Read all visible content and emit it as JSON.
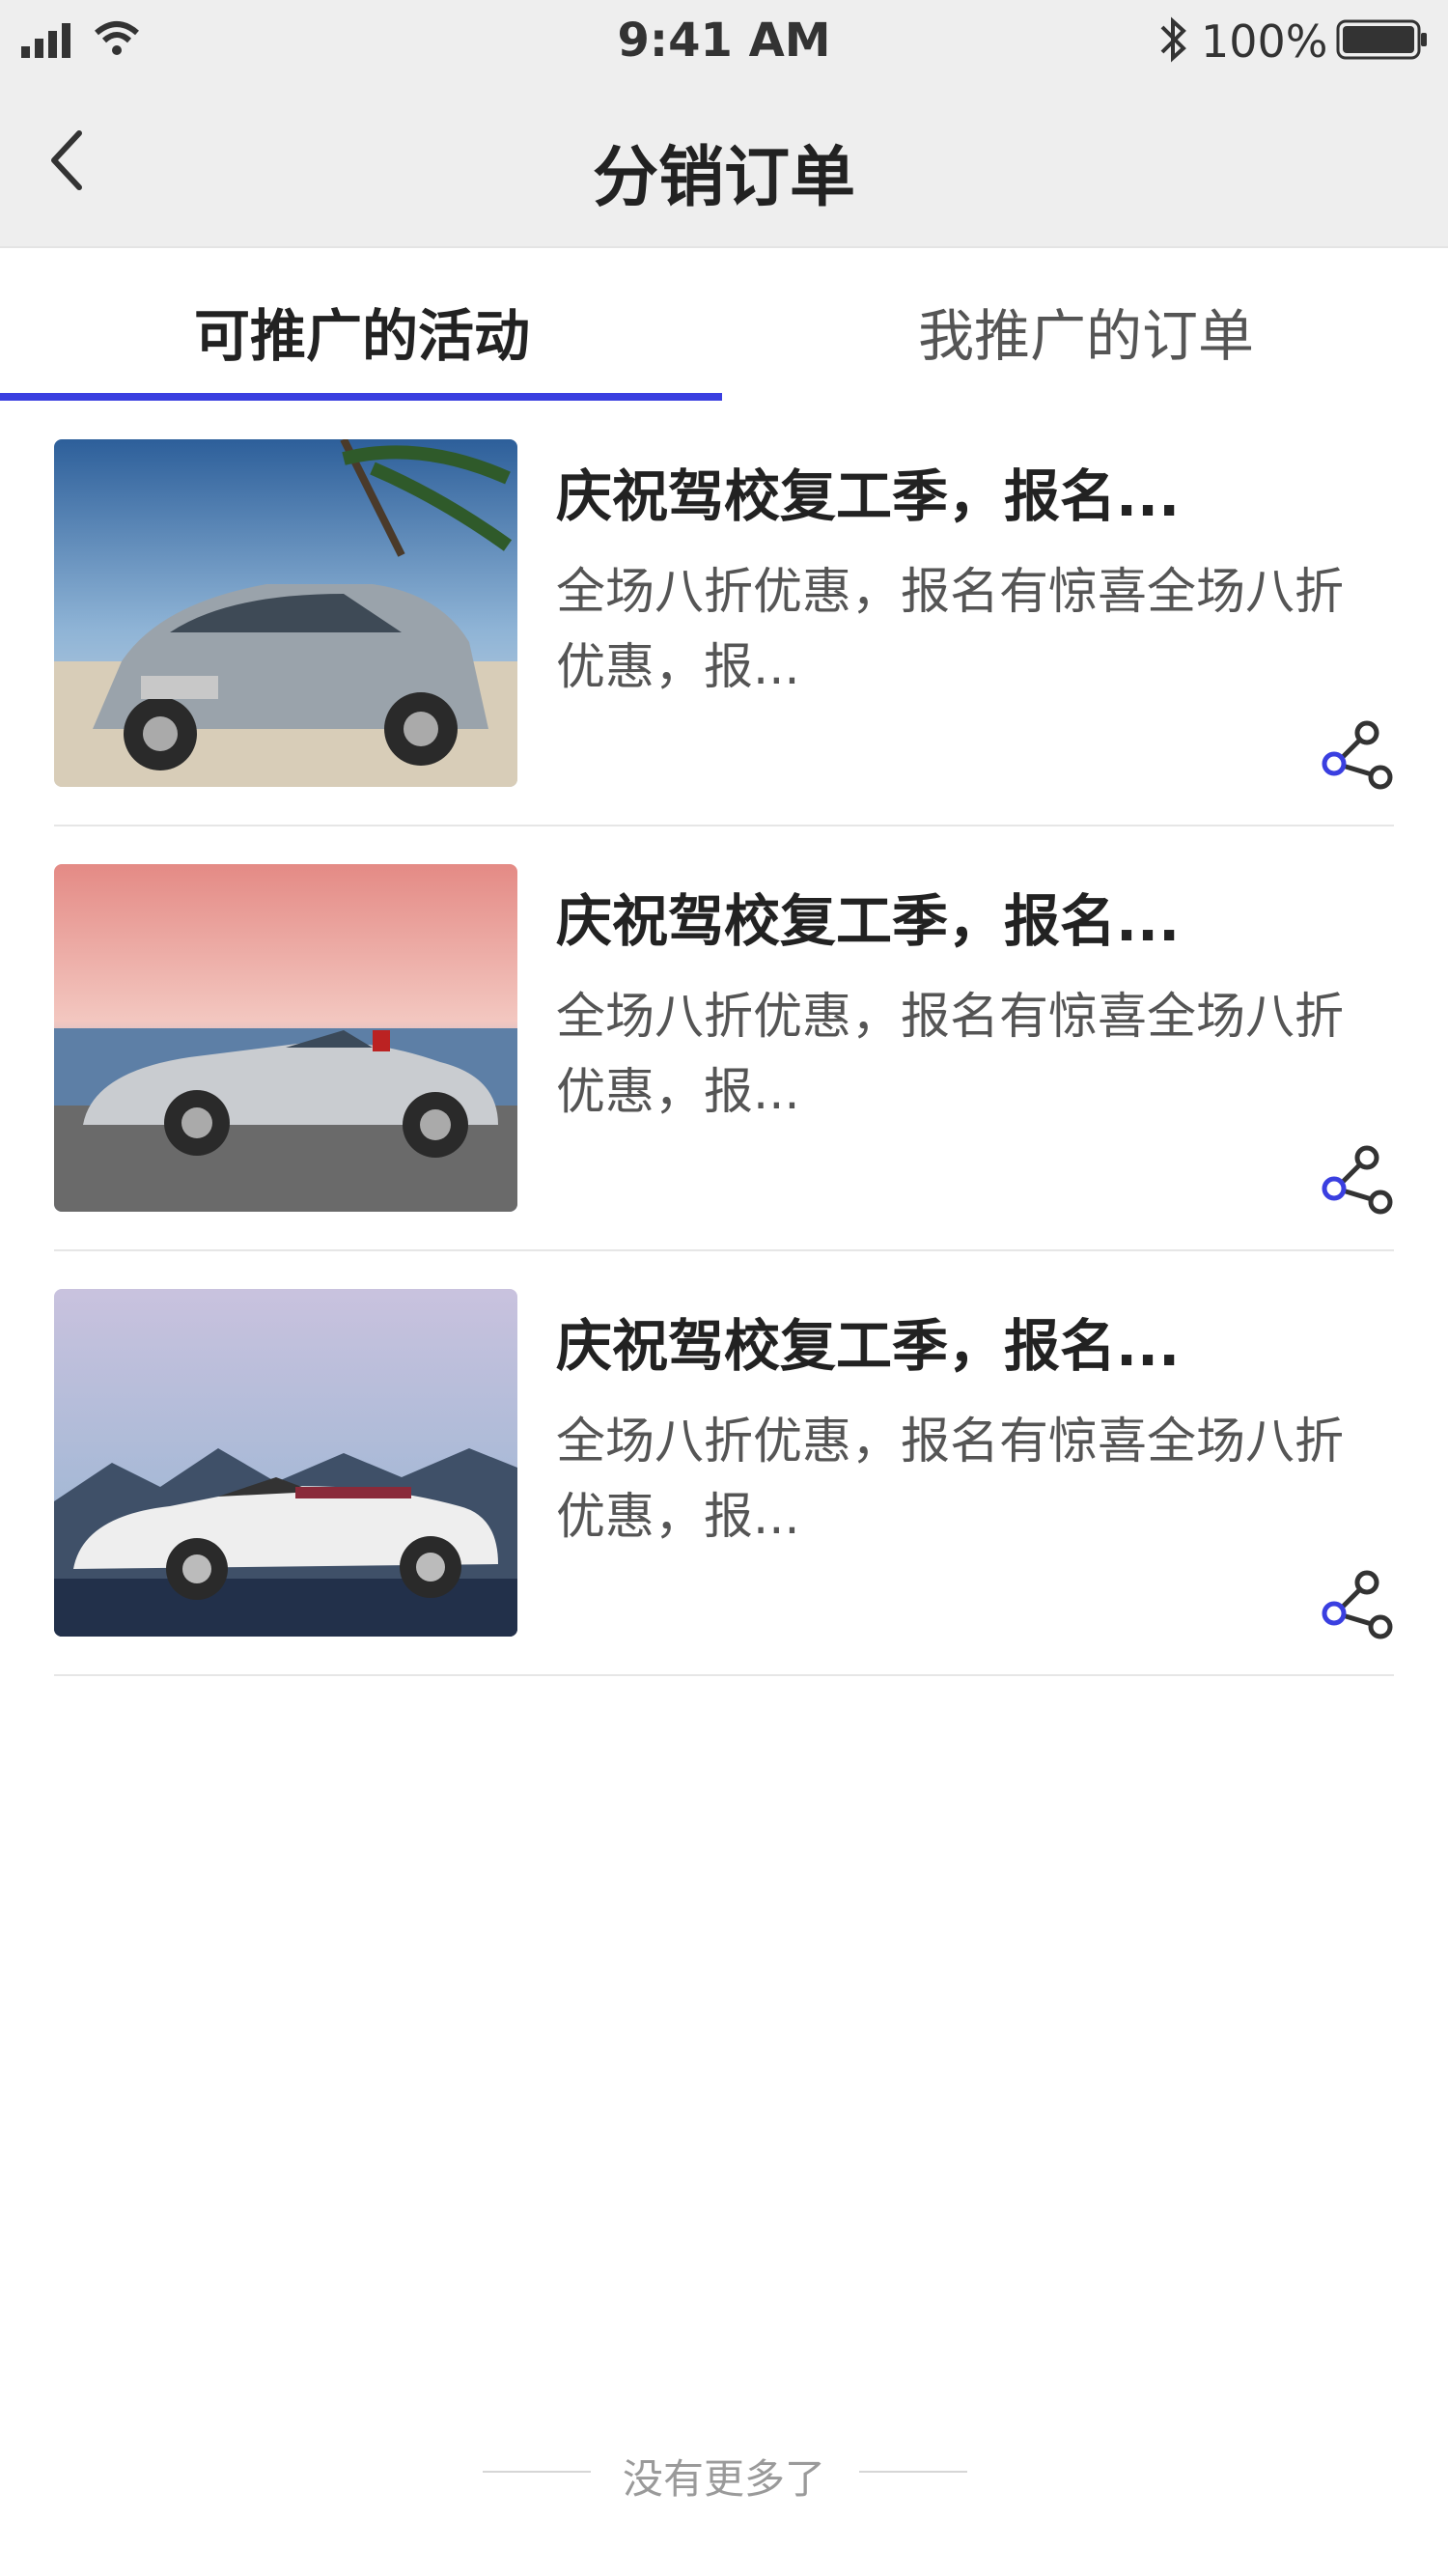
{
  "status_bar": {
    "time": "9:41 AM",
    "battery": "100%"
  },
  "nav": {
    "title": "分销订单"
  },
  "tabs": [
    {
      "label": "可推广的活动",
      "active": true
    },
    {
      "label": "我推广的订单",
      "active": false
    }
  ],
  "activities": [
    {
      "title": "庆祝驾校复工季，报名...",
      "desc": "全场八折优惠，报名有惊喜全场八折优惠，报...",
      "image": "silver-suv-beach"
    },
    {
      "title": "庆祝驾校复工季，报名...",
      "desc": "全场八折优惠，报名有惊喜全场八折优惠，报...",
      "image": "silver-roadster-coast"
    },
    {
      "title": "庆祝驾校复工季，报名...",
      "desc": "全场八折优惠，报名有惊喜全场八折优惠，报...",
      "image": "white-convertible-mountains"
    }
  ],
  "footer": {
    "text": "没有更多了"
  },
  "colors": {
    "accent": "#3a3fe0",
    "title": "#222222",
    "body": "#555555"
  },
  "icons": {
    "back": "chevron-left-icon",
    "share": "share-icon"
  }
}
